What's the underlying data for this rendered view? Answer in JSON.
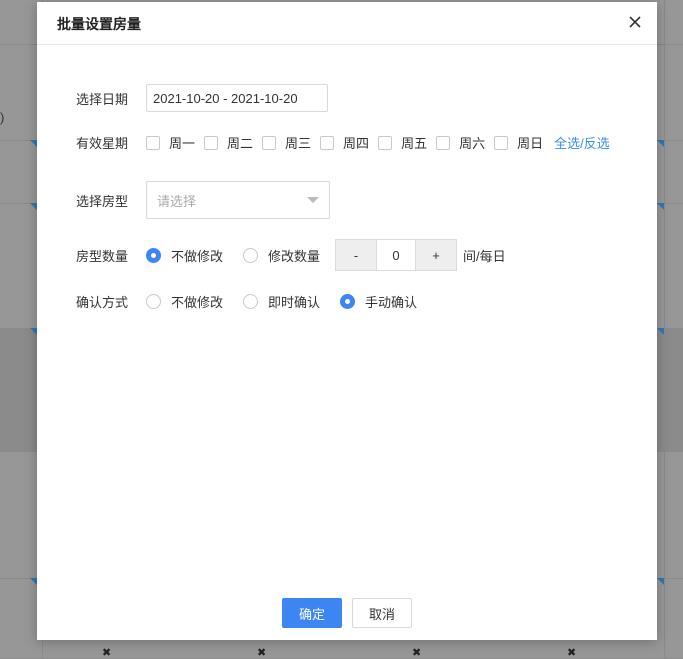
{
  "background": {
    "paren": ")",
    "row_mark": "✖"
  },
  "modal": {
    "title": "批量设置房量",
    "close_icon": "close-icon"
  },
  "form": {
    "date": {
      "label": "选择日期",
      "value": "2021-10-20 - 2021-10-20"
    },
    "weekdays": {
      "label": "有效星期",
      "days": [
        "周一",
        "周二",
        "周三",
        "周四",
        "周五",
        "周六",
        "周日"
      ],
      "toggle_all": "全选/反选"
    },
    "room_type": {
      "label": "选择房型",
      "placeholder": "请选择"
    },
    "room_count": {
      "label": "房型数量",
      "options": [
        "不做修改",
        "修改数量"
      ],
      "selected": "不做修改",
      "minus": "-",
      "value": "0",
      "plus": "+",
      "unit": "间/每日"
    },
    "confirm_mode": {
      "label": "确认方式",
      "options": [
        "不做修改",
        "即时确认",
        "手动确认"
      ],
      "selected": "手动确认"
    }
  },
  "footer": {
    "ok": "确定",
    "cancel": "取消"
  },
  "colors": {
    "primary": "#3b86f2",
    "link": "#3a8ee6"
  }
}
